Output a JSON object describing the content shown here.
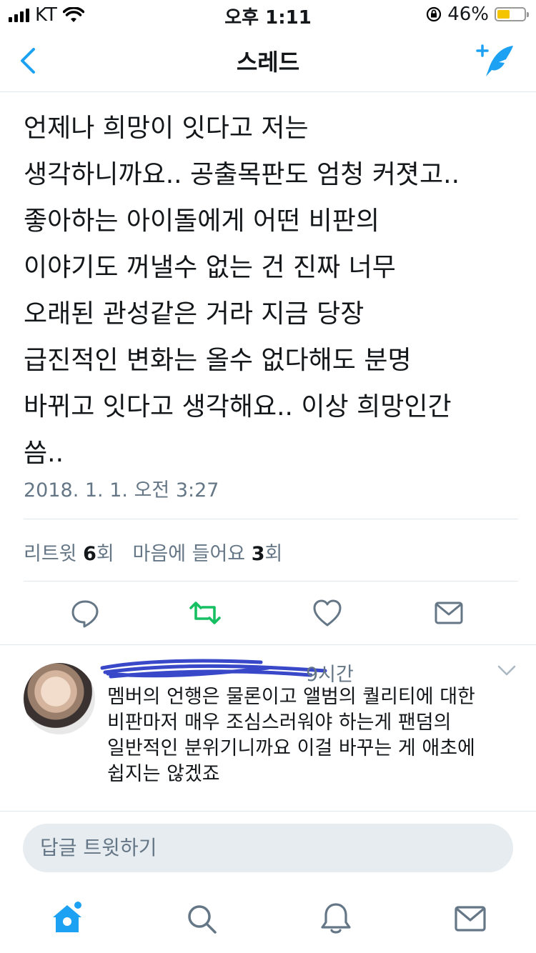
{
  "status_bar": {
    "carrier": "KT",
    "time": "오후 1:11",
    "battery": "46%",
    "battery_level": 0.46
  },
  "nav": {
    "title": "스레드",
    "back_icon": "chevron-left-icon",
    "compose_icon": "compose-tweet-icon"
  },
  "tweet": {
    "text": "언제나 희망이 잇다고 저는\n생각하니까요.. 공출목판도 엄청 커졋고..\n좋아하는 아이돌에게 어떤 비판의\n이야기도 꺼낼수 없는 건 진짜 너무\n오래된 관성같은 거라 지금 당장\n급진적인 변화는 올수 없다해도 분명\n바뀌고 잇다고 생각해요.. 이상 희망인간\n씀..",
    "timestamp": "2018. 1. 1. 오전 3:27",
    "retweets_label": "리트윗",
    "retweets_count": "6",
    "retweets_unit": "회",
    "likes_label": "마음에 들어요",
    "likes_count": "3",
    "likes_unit": "회"
  },
  "actions": [
    "reply-icon",
    "retweet-icon",
    "like-icon",
    "direct-message-icon"
  ],
  "reply": {
    "time": "9시간",
    "text": "멤버의 언행은 물론이고 앨범의 퀄리티에 대한\n비판마저 매우 조심스러워야 하는게 팬덤의\n일반적인 분위기니까요 이걸 바꾸는 게 애초에\n쉽지는 않겠죠"
  },
  "reply_input": {
    "placeholder": "답글 트윗하기"
  },
  "tab_bar": [
    "home-icon",
    "search-icon",
    "notifications-icon",
    "messages-icon"
  ],
  "colors": {
    "accent": "#1da1f2",
    "retweet_active": "#17bf63",
    "secondary_text": "#657786",
    "icon_gray": "#657786"
  }
}
